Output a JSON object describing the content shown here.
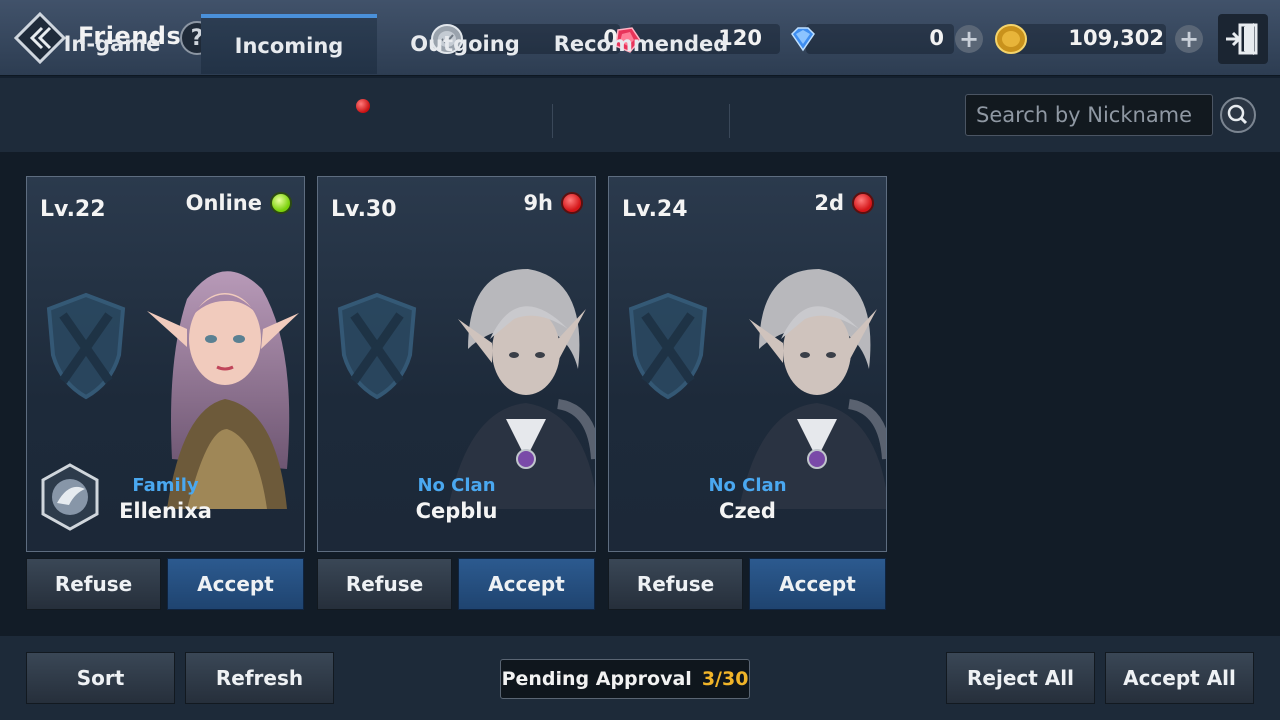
{
  "header": {
    "title": "Friends",
    "help_label": "?"
  },
  "currencies": [
    {
      "name": "silver-coin-icon",
      "value": "0"
    },
    {
      "name": "red-gem-icon",
      "value": "120"
    },
    {
      "name": "blue-diamond-icon",
      "value": "0"
    },
    {
      "name": "gold-coin-icon",
      "value": "109,302"
    }
  ],
  "tabs": [
    {
      "label": "In-game",
      "active": false
    },
    {
      "label": "Incoming",
      "active": true,
      "notification": true
    },
    {
      "label": "Outgoing",
      "active": false
    },
    {
      "label": "Recommended",
      "active": false
    }
  ],
  "search": {
    "placeholder": "Search by Nickname"
  },
  "requests": [
    {
      "level": "Lv.22",
      "status": "Online",
      "online": true,
      "clan": "Family",
      "nickname": "Ellenixa",
      "refuse": "Refuse",
      "accept": "Accept"
    },
    {
      "level": "Lv.30",
      "status": "9h",
      "online": false,
      "clan": "No Clan",
      "nickname": "Cepblu",
      "refuse": "Refuse",
      "accept": "Accept"
    },
    {
      "level": "Lv.24",
      "status": "2d",
      "online": false,
      "clan": "No Clan",
      "nickname": "Czed",
      "refuse": "Refuse",
      "accept": "Accept"
    }
  ],
  "footer": {
    "sort": "Sort",
    "refresh": "Refresh",
    "pending_label": "Pending Approval",
    "pending_count": "3/30",
    "reject_all": "Reject All",
    "accept_all": "Accept All"
  },
  "colors": {
    "accent": "#4a90d9",
    "clan_text": "#4aa8f0",
    "online": "#7bd10c",
    "offline": "#d41518",
    "pending_count": "#f0b429"
  }
}
